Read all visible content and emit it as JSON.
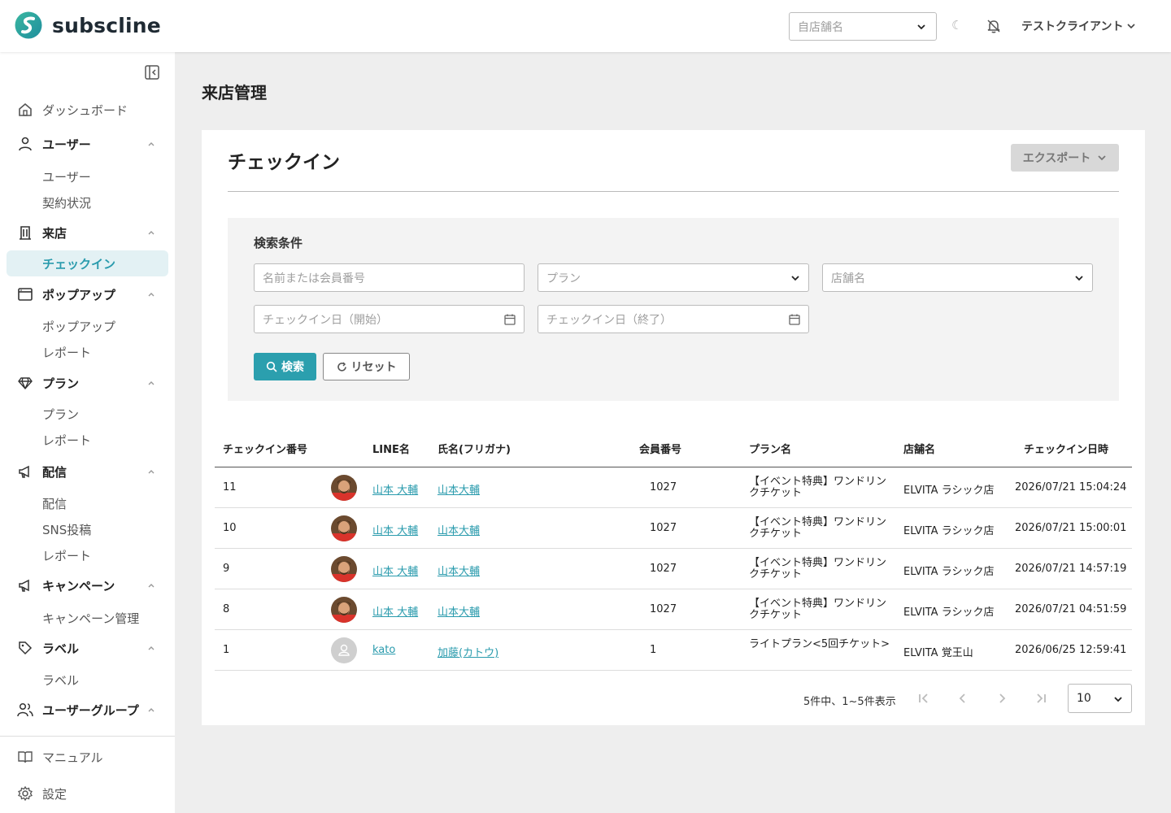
{
  "app": {
    "name": "subscline"
  },
  "header": {
    "store_placeholder": "自店舗名",
    "client_name": "テストクライアント",
    "dark_glyph": "☾"
  },
  "sidebar": {
    "dashboard": "ダッシュボード",
    "groups": {
      "user": {
        "label": "ユーザー",
        "items": [
          "ユーザー",
          "契約状況"
        ]
      },
      "visit": {
        "label": "来店",
        "items": [
          "チェックイン"
        ]
      },
      "popup": {
        "label": "ポップアップ",
        "items": [
          "ポップアップ",
          "レポート"
        ]
      },
      "plan": {
        "label": "プラン",
        "items": [
          "プラン",
          "レポート"
        ]
      },
      "delivery": {
        "label": "配信",
        "items": [
          "配信",
          "SNS投稿",
          "レポート"
        ]
      },
      "campaign": {
        "label": "キャンペーン",
        "items": [
          "キャンペーン管理"
        ]
      },
      "label": {
        "label": "ラベル",
        "items": [
          "ラベル"
        ]
      },
      "usergroup": {
        "label": "ユーザーグループ"
      }
    },
    "manual": "マニュアル",
    "settings": "設定"
  },
  "page": {
    "title": "来店管理",
    "card_title": "チェックイン",
    "export_label": "エクスポート"
  },
  "search": {
    "title": "検索条件",
    "name_placeholder": "名前または会員番号",
    "plan_placeholder": "プラン",
    "store_placeholder": "店舗名",
    "date_start_placeholder": "チェックイン日（開始）",
    "date_end_placeholder": "チェックイン日（終了）",
    "search_label": "検索",
    "reset_label": "リセット"
  },
  "table": {
    "headers": [
      "チェックイン番号",
      "LINE名",
      "氏名(フリガナ)",
      "会員番号",
      "プラン名",
      "店舗名",
      "チェックイン日時"
    ],
    "rows": [
      {
        "id": "11",
        "line": "山本 大輔",
        "name": "山本大輔",
        "member": "1027",
        "plan": "【イベント特典】ワンドリンクチケット",
        "store": "ELVITA ラシック店",
        "datetime": "2026/07/21 15:04:24",
        "avatar": "photo"
      },
      {
        "id": "10",
        "line": "山本 大輔",
        "name": "山本大輔",
        "member": "1027",
        "plan": "【イベント特典】ワンドリンクチケット",
        "store": "ELVITA ラシック店",
        "datetime": "2026/07/21 15:00:01",
        "avatar": "photo"
      },
      {
        "id": "9",
        "line": "山本 大輔",
        "name": "山本大輔",
        "member": "1027",
        "plan": "【イベント特典】ワンドリンクチケット",
        "store": "ELVITA ラシック店",
        "datetime": "2026/07/21 14:57:19",
        "avatar": "photo"
      },
      {
        "id": "8",
        "line": "山本 大輔",
        "name": "山本大輔",
        "member": "1027",
        "plan": "【イベント特典】ワンドリンクチケット",
        "store": "ELVITA ラシック店",
        "datetime": "2026/07/21 04:51:59",
        "avatar": "photo"
      },
      {
        "id": "1",
        "line": "kato",
        "name": "加藤(カトウ)",
        "member": "1",
        "plan": "ライトプラン<5回チケット>",
        "store": "ELVITA 覚王山",
        "datetime": "2026/06/25 12:59:41",
        "avatar": "placeholder"
      }
    ]
  },
  "pagination": {
    "summary": "5件中、1~5件表示",
    "per_page": "10"
  },
  "colors": {
    "accent": "#2b9fae",
    "active_bg": "#e3f1f4"
  }
}
